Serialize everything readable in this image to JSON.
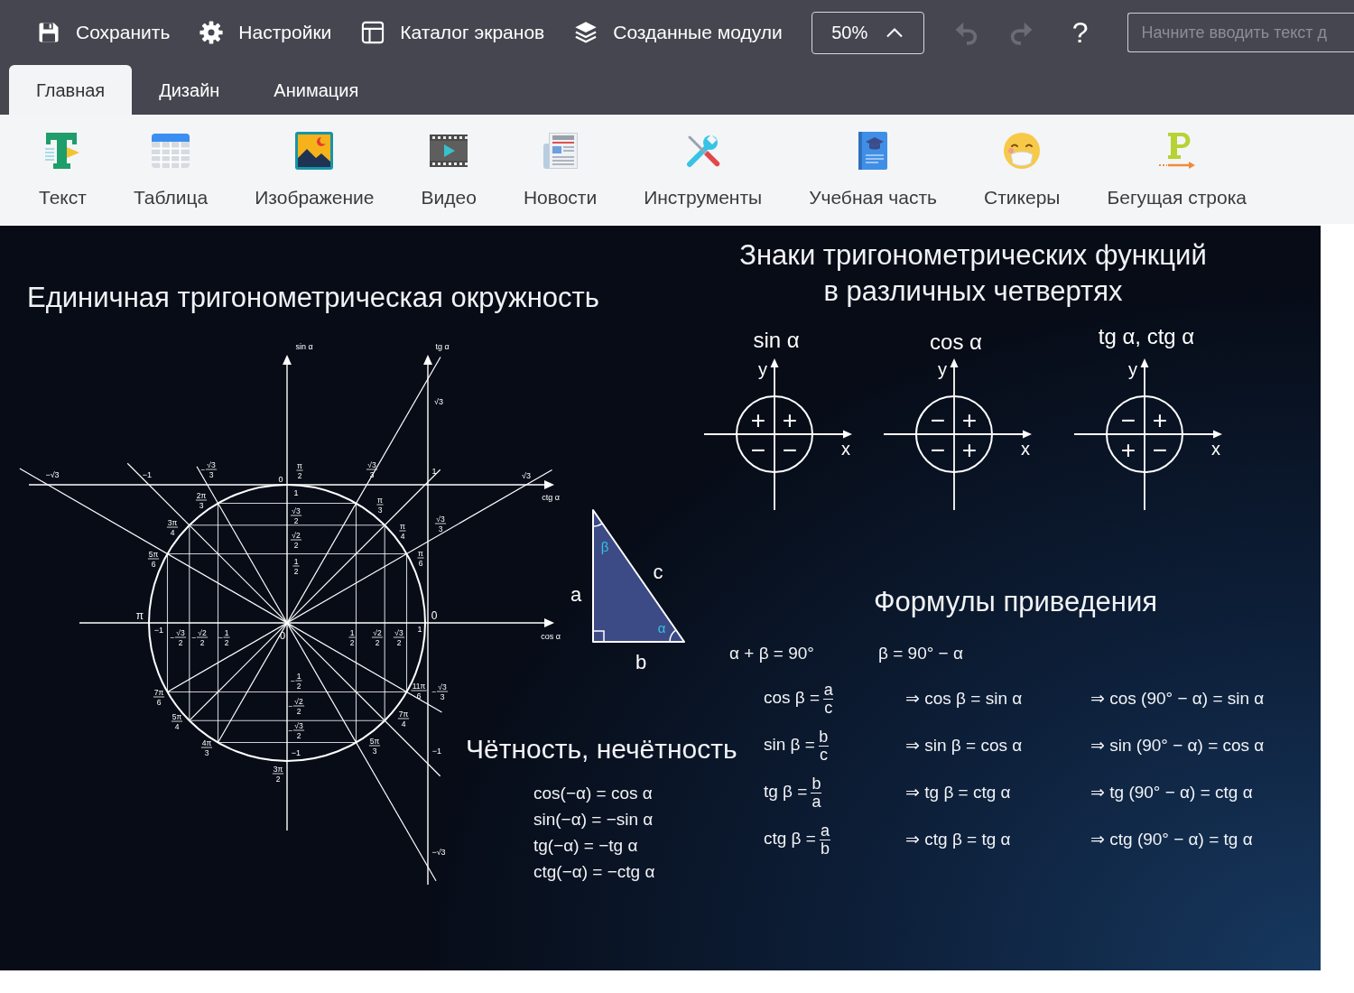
{
  "toolbar": {
    "buttons": [
      {
        "label": "Сохранить"
      },
      {
        "label": "Настройки"
      },
      {
        "label": "Каталог экранов"
      },
      {
        "label": "Созданные модули"
      }
    ],
    "zoom": {
      "value": "50%"
    },
    "undo": {
      "disabled": true
    },
    "redo": {
      "disabled": true
    },
    "help": "?",
    "search": {
      "placeholder": "Начните вводить текст д"
    }
  },
  "tabs": [
    {
      "label": "Главная",
      "selected": true
    },
    {
      "label": "Дизайн",
      "selected": false
    },
    {
      "label": "Анимация",
      "selected": false
    }
  ],
  "ribbon": [
    {
      "label": "Текст"
    },
    {
      "label": "Таблица"
    },
    {
      "label": "Изображение"
    },
    {
      "label": "Видео"
    },
    {
      "label": "Новости"
    },
    {
      "label": "Инструменты"
    },
    {
      "label": "Учебная часть"
    },
    {
      "label": "Стикеры"
    },
    {
      "label": "Бегущая строка"
    }
  ],
  "slide": {
    "unit_circle": {
      "title": "Единичная тригонометрическая окружность",
      "axis_labels": {
        "sin": "sin α",
        "tg": "tg α",
        "ctg": "ctg α",
        "cos": "cos α"
      },
      "origin": "0",
      "angles": [
        "0",
        {
          "num": "π",
          "den": "6"
        },
        {
          "num": "π",
          "den": "4"
        },
        {
          "num": "π",
          "den": "3"
        },
        {
          "num": "π",
          "den": "2"
        },
        {
          "num": "2π",
          "den": "3"
        },
        {
          "num": "3π",
          "den": "4"
        },
        {
          "num": "5π",
          "den": "6"
        },
        "π",
        {
          "num": "7π",
          "den": "6"
        },
        {
          "num": "5π",
          "den": "4"
        },
        {
          "num": "4π",
          "den": "3"
        },
        {
          "num": "3π",
          "den": "2"
        },
        {
          "num": "5π",
          "den": "3"
        },
        {
          "num": "7π",
          "den": "4"
        },
        {
          "num": "11π",
          "den": "6"
        }
      ],
      "sin_ticks": [
        "1",
        {
          "num": "√3",
          "den": "2"
        },
        {
          "num": "√2",
          "den": "2"
        },
        {
          "num": "1",
          "den": "2"
        },
        {
          "sign": "−",
          "num": "1",
          "den": "2"
        },
        {
          "sign": "−",
          "num": "√2",
          "den": "2"
        },
        {
          "sign": "−",
          "num": "√3",
          "den": "2"
        },
        "−1"
      ],
      "cos_ticks": [
        "−1",
        {
          "sign": "−",
          "num": "√3",
          "den": "2"
        },
        {
          "sign": "−",
          "num": "√2",
          "den": "2"
        },
        {
          "sign": "−",
          "num": "1",
          "den": "2"
        },
        {
          "num": "1",
          "den": "2"
        },
        {
          "num": "√2",
          "den": "2"
        },
        {
          "num": "√3",
          "den": "2"
        },
        "1"
      ],
      "tg_ticks": [
        "√3",
        "1",
        {
          "num": "√3",
          "den": "3"
        },
        {
          "sign": "−",
          "num": "√3",
          "den": "3"
        },
        "−1",
        "−√3"
      ],
      "ctg_ticks": [
        "−√3",
        "−1",
        {
          "sign": "−",
          "num": "√3",
          "den": "3"
        },
        "0",
        {
          "num": "√3",
          "den": "3"
        },
        "√3"
      ]
    },
    "triangle": {
      "sides": [
        "a",
        "b",
        "c"
      ],
      "angles": [
        "β",
        "α"
      ]
    },
    "signs": {
      "title": "Знаки тригонометрических функций в различных четвертях",
      "diagrams": [
        {
          "title": "sin α",
          "x_label": "x",
          "y_label": "y",
          "signs": {
            "q1": "+",
            "q2": "+",
            "q3": "−",
            "q4": "−"
          }
        },
        {
          "title": "cos α",
          "x_label": "x",
          "y_label": "y",
          "signs": {
            "q1": "+",
            "q2": "−",
            "q3": "−",
            "q4": "+"
          }
        },
        {
          "title": "tg α, ctg α",
          "x_label": "x",
          "y_label": "y",
          "signs": {
            "q1": "+",
            "q2": "−",
            "q3": "+",
            "q4": "−"
          }
        }
      ]
    },
    "reduction": {
      "title": "Формулы приведения",
      "relations": [
        "α + β = 90°",
        "β = 90° − α"
      ],
      "rows": [
        {
          "ratio": {
            "lhs": "cos β =",
            "num": "a",
            "den": "c"
          },
          "result": "⇒ cos β = sin α",
          "general": "⇒ cos (90° − α) = sin α"
        },
        {
          "ratio": {
            "lhs": "sin β =",
            "num": "b",
            "den": "c"
          },
          "result": "⇒ sin β = cos α",
          "general": "⇒ sin (90° − α) = cos α"
        },
        {
          "ratio": {
            "lhs": "tg β =",
            "num": "b",
            "den": "a"
          },
          "result": "⇒ tg β = ctg α",
          "general": "⇒ tg (90° − α) = ctg α"
        },
        {
          "ratio": {
            "lhs": "ctg β =",
            "num": "a",
            "den": "b"
          },
          "result": "⇒ ctg β = tg α",
          "general": "⇒ ctg (90° − α) = tg α"
        }
      ]
    },
    "parity": {
      "title": "Чётность, нечётность",
      "formulas": [
        "cos(−α) = cos α",
        "sin(−α) = −sin α",
        "tg(−α) = −tg α",
        "ctg(−α) = −ctg α"
      ]
    }
  }
}
